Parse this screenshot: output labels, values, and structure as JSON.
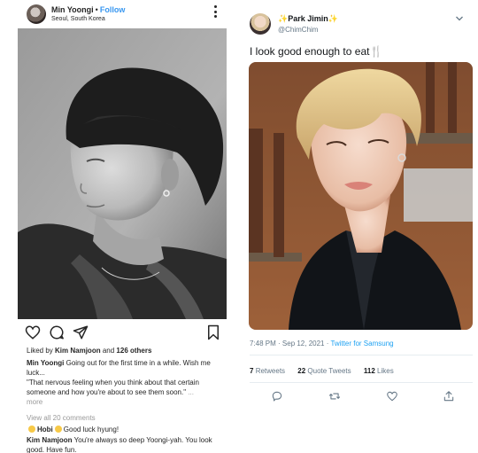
{
  "instagram": {
    "username": "Min Yoongi",
    "separator": "•",
    "follow_label": "Follow",
    "location": "Seoul, South Korea",
    "likes": {
      "prefix": "Liked by",
      "first_liker": "Kim Namjoon",
      "middle": "and",
      "others": "126 others"
    },
    "caption": {
      "author": "Min Yoongi",
      "line1": "Going out for the first time in a while. Wish me luck...",
      "line2": "\"That nervous feeling when you think about that certain someone and how you're about to see them soon.\"",
      "ellipsis": "...",
      "more": "more"
    },
    "view_comments": "View all 20 comments",
    "comments": [
      {
        "author": "Hobi",
        "text": "Good luck hyung!"
      },
      {
        "author": "Kim Namjoon",
        "text": "You're always so deep Yoongi-yah. You look good. Have fun."
      }
    ],
    "icons": {
      "like": "heart-icon",
      "comment": "comment-icon",
      "share": "paper-plane-icon",
      "save": "bookmark-icon",
      "more": "more-dots-icon"
    }
  },
  "twitter": {
    "display_name": "Park Jimin",
    "sparkle": "✨",
    "handle": "@ChimChim",
    "tweet_text": "I look good enough to eat",
    "tweet_emoji": "🍴",
    "timestamp": "7:48 PM · Sep 12, 2021 ·",
    "source": "Twitter for Samsung",
    "stats": {
      "retweets_count": "7",
      "retweets_label": "Retweets",
      "quotes_count": "22",
      "quotes_label": "Quote Tweets",
      "likes_count": "112",
      "likes_label": "Likes"
    },
    "icons": {
      "reply": "reply-icon",
      "retweet": "retweet-icon",
      "like": "heart-icon",
      "share": "share-icon",
      "menu": "chevron-down-icon"
    },
    "colors": {
      "accent": "#1da1f2",
      "muted": "#657786"
    }
  }
}
